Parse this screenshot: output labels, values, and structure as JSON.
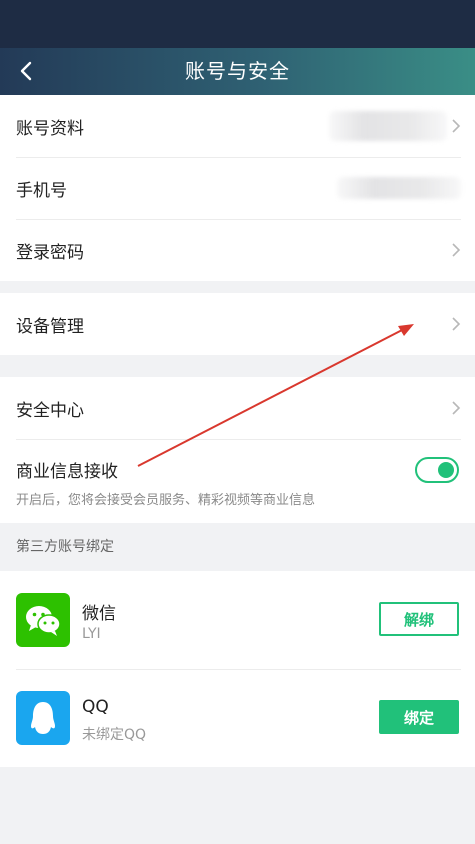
{
  "header": {
    "back_icon": "chevron-left-icon",
    "title": "账号与安全"
  },
  "account_group": [
    {
      "label": "账号资料",
      "has_chevron": true
    },
    {
      "label": "手机号",
      "has_chevron": false
    },
    {
      "label": "登录密码",
      "has_chevron": true
    }
  ],
  "device_group": [
    {
      "label": "设备管理",
      "has_chevron": true
    }
  ],
  "security_group": {
    "item": {
      "label": "安全中心",
      "has_chevron": true
    },
    "commercial": {
      "label": "商业信息接收",
      "description": "开启后，您将会接受会员服务、精彩视频等商业信息",
      "enabled": true
    }
  },
  "third_party": {
    "section_title": "第三方账号绑定",
    "items": [
      {
        "name": "微信",
        "sub": "LYI",
        "button": "解绑",
        "icon": "wechat-icon",
        "color": "#2dc100"
      },
      {
        "name": "QQ",
        "sub": "未绑定QQ",
        "button": "绑定",
        "icon": "qq-icon",
        "color": "#1aa6ef"
      }
    ]
  },
  "colors": {
    "accent": "#21c17a",
    "header_start": "#233a57",
    "header_end": "#3a8e86",
    "annotation_arrow": "#d9382e"
  }
}
